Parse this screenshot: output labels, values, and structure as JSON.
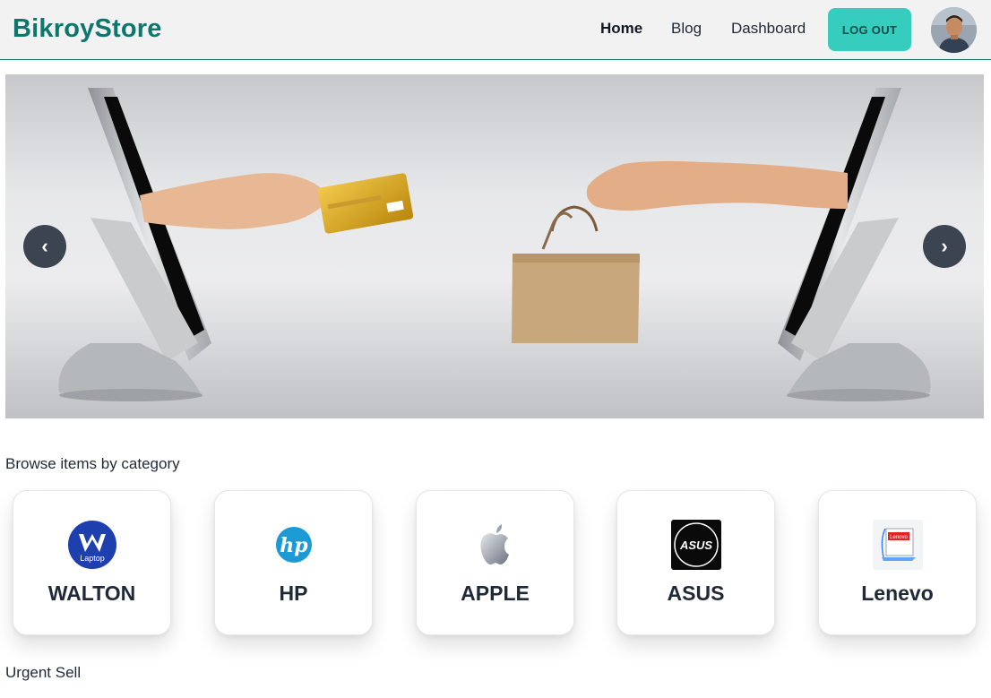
{
  "navbar": {
    "brand": "BikroyStore",
    "links": [
      "Home",
      "Blog",
      "Dashboard"
    ],
    "logout_label": "LOG OUT",
    "brand_color": "#0f766e",
    "accent_color": "#37cdbe"
  },
  "carousel": {
    "prev_label": "‹",
    "next_label": "›"
  },
  "categories": {
    "title": "Browse items by category",
    "items": [
      {
        "name": "WALTON",
        "logo_text": "Laptop"
      },
      {
        "name": "HP",
        "logo_text": "hp"
      },
      {
        "name": "APPLE",
        "logo_text": ""
      },
      {
        "name": "ASUS",
        "logo_text": "ASUS"
      },
      {
        "name": "Lenevo",
        "logo_text": "Lenovo"
      }
    ]
  },
  "urgent": {
    "title": "Urgent Sell"
  }
}
